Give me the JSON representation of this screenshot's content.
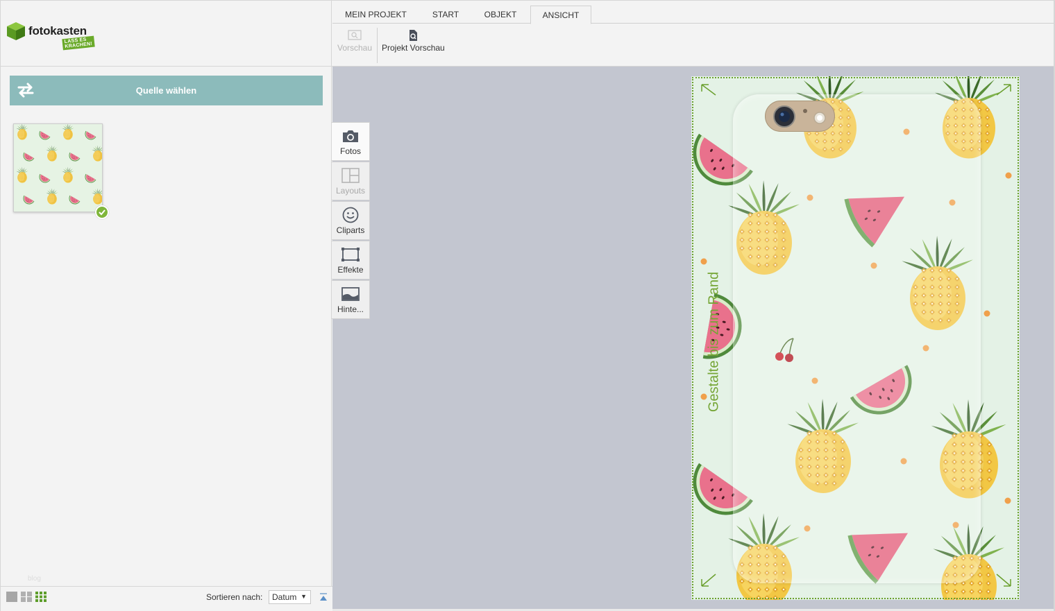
{
  "app": {
    "brand": "fotokasten",
    "slogan": "LASS ES KRACHEN!"
  },
  "tabs": [
    {
      "label": "MEIN PROJEKT",
      "active": false
    },
    {
      "label": "START",
      "active": false
    },
    {
      "label": "OBJEKT",
      "active": false
    },
    {
      "label": "ANSICHT",
      "active": true
    }
  ],
  "ribbon": {
    "preview_label": "Vorschau",
    "preview_disabled": true,
    "project_preview_label": "Projekt Vorschau"
  },
  "left_panel": {
    "source_button_label": "Quelle wählen",
    "blog_label": "blog",
    "photos": [
      {
        "name": "fruit-pattern",
        "selected": true
      }
    ],
    "sort_label": "Sortieren nach:",
    "sort_value": "Datum"
  },
  "tools": [
    {
      "label": "Fotos",
      "icon": "camera-icon",
      "active": true,
      "disabled": false
    },
    {
      "label": "Layouts",
      "icon": "layout-icon",
      "active": false,
      "disabled": true
    },
    {
      "label": "Cliparts",
      "icon": "smiley-icon",
      "active": false,
      "disabled": false
    },
    {
      "label": "Effekte",
      "icon": "frame-icon",
      "active": false,
      "disabled": false
    },
    {
      "label": "Hinte...",
      "icon": "background-icon",
      "active": false,
      "disabled": false
    }
  ],
  "design": {
    "margin_hint": "Gestalte bis zum Rand",
    "accent_color": "#75a535"
  }
}
